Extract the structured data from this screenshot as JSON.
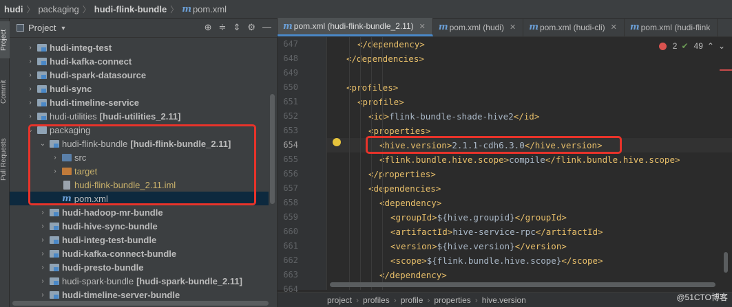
{
  "breadcrumb": {
    "items": [
      "hudi",
      "packaging",
      "hudi-flink-bundle"
    ],
    "file": "pom.xml",
    "file_icon": "m"
  },
  "toolstrip": {
    "tabs": [
      "Project",
      "Commit",
      "Pull Requests"
    ]
  },
  "project_panel": {
    "title": "Project",
    "icons": [
      "locate-icon",
      "expand-icon",
      "collapse-icon",
      "gear-icon",
      "minimize-icon"
    ],
    "rows": [
      {
        "indent": 1,
        "arrow": "›",
        "icon": "mod",
        "name": "hudi-integ-test",
        "suffix": "",
        "bold": true,
        "color": "default"
      },
      {
        "indent": 1,
        "arrow": "›",
        "icon": "mod",
        "name": "hudi-kafka-connect",
        "suffix": "",
        "bold": true,
        "color": "default"
      },
      {
        "indent": 1,
        "arrow": "›",
        "icon": "mod",
        "name": "hudi-spark-datasource",
        "suffix": "",
        "bold": true,
        "color": "default"
      },
      {
        "indent": 1,
        "arrow": "›",
        "icon": "mod",
        "name": "hudi-sync",
        "suffix": "",
        "bold": true,
        "color": "default"
      },
      {
        "indent": 1,
        "arrow": "›",
        "icon": "mod",
        "name": "hudi-timeline-service",
        "suffix": "",
        "bold": true,
        "color": "default"
      },
      {
        "indent": 1,
        "arrow": "›",
        "icon": "mod",
        "name": "hudi-utilities",
        "suffix": "[hudi-utilities_2.11]",
        "bold": false,
        "color": "default"
      },
      {
        "indent": 1,
        "arrow": "⌄",
        "icon": "plain",
        "name": "packaging",
        "suffix": "",
        "bold": false,
        "color": "default"
      },
      {
        "indent": 2,
        "arrow": "⌄",
        "icon": "mod",
        "name": "hudi-flink-bundle",
        "suffix": "[hudi-flink-bundle_2.11]",
        "bold": false,
        "color": "default"
      },
      {
        "indent": 3,
        "arrow": "›",
        "icon": "src",
        "name": "src",
        "suffix": "",
        "bold": false,
        "color": "default"
      },
      {
        "indent": 3,
        "arrow": "›",
        "icon": "target",
        "name": "target",
        "suffix": "",
        "bold": false,
        "color": "yellow"
      },
      {
        "indent": 3,
        "arrow": "",
        "icon": "iml",
        "name": "hudi-flink-bundle_2.11.iml",
        "suffix": "",
        "bold": false,
        "color": "yellow"
      },
      {
        "indent": 3,
        "arrow": "",
        "icon": "m",
        "name": "pom.xml",
        "suffix": "",
        "bold": false,
        "color": "default",
        "selected": true
      },
      {
        "indent": 2,
        "arrow": "›",
        "icon": "mod",
        "name": "hudi-hadoop-mr-bundle",
        "suffix": "",
        "bold": true,
        "color": "default"
      },
      {
        "indent": 2,
        "arrow": "›",
        "icon": "mod",
        "name": "hudi-hive-sync-bundle",
        "suffix": "",
        "bold": true,
        "color": "default"
      },
      {
        "indent": 2,
        "arrow": "›",
        "icon": "mod",
        "name": "hudi-integ-test-bundle",
        "suffix": "",
        "bold": true,
        "color": "default"
      },
      {
        "indent": 2,
        "arrow": "›",
        "icon": "mod",
        "name": "hudi-kafka-connect-bundle",
        "suffix": "",
        "bold": true,
        "color": "default"
      },
      {
        "indent": 2,
        "arrow": "›",
        "icon": "mod",
        "name": "hudi-presto-bundle",
        "suffix": "",
        "bold": true,
        "color": "default"
      },
      {
        "indent": 2,
        "arrow": "›",
        "icon": "mod",
        "name": "hudi-spark-bundle",
        "suffix": "[hudi-spark-bundle_2.11]",
        "bold": false,
        "color": "default"
      },
      {
        "indent": 2,
        "arrow": "›",
        "icon": "mod",
        "name": "hudi-timeline-server-bundle",
        "suffix": "",
        "bold": true,
        "color": "default"
      }
    ]
  },
  "editor": {
    "tabs": [
      {
        "label": "pom.xml (hudi-flink-bundle_2.11)",
        "active": true
      },
      {
        "label": "pom.xml (hudi)",
        "active": false
      },
      {
        "label": "pom.xml (hudi-cli)",
        "active": false
      },
      {
        "label": "pom.xml (hudi-flink",
        "active": false
      }
    ],
    "inspections": {
      "errors": "2",
      "warnings": "49"
    },
    "lines": [
      {
        "no": "647",
        "indent": 2,
        "tokens": [
          [
            "tag",
            "</dependency>"
          ]
        ]
      },
      {
        "no": "648",
        "indent": 1,
        "tokens": [
          [
            "tag",
            "</dependencies>"
          ]
        ]
      },
      {
        "no": "649",
        "indent": 0,
        "tokens": []
      },
      {
        "no": "650",
        "indent": 1,
        "tokens": [
          [
            "tag",
            "<profiles>"
          ]
        ]
      },
      {
        "no": "651",
        "indent": 2,
        "tokens": [
          [
            "tag",
            "<profile>"
          ]
        ]
      },
      {
        "no": "652",
        "indent": 3,
        "tokens": [
          [
            "tag",
            "<id>"
          ],
          [
            "txt",
            "flink-bundle-shade-hive2"
          ],
          [
            "tag",
            "</id>"
          ]
        ]
      },
      {
        "no": "653",
        "indent": 3,
        "tokens": [
          [
            "tag",
            "<properties>"
          ]
        ]
      },
      {
        "no": "654",
        "indent": 4,
        "tokens": [
          [
            "tag",
            "<hive.version>"
          ],
          [
            "txt",
            "2.1.1-cdh6.3.0"
          ],
          [
            "tag",
            "</hive.version>"
          ]
        ],
        "current": true
      },
      {
        "no": "655",
        "indent": 4,
        "tokens": [
          [
            "tag",
            "<flink.bundle.hive.scope>"
          ],
          [
            "txt",
            "compile"
          ],
          [
            "tag",
            "</flink.bundle.hive.scope>"
          ]
        ]
      },
      {
        "no": "656",
        "indent": 3,
        "tokens": [
          [
            "tag",
            "</properties>"
          ]
        ]
      },
      {
        "no": "657",
        "indent": 3,
        "tokens": [
          [
            "tag",
            "<dependencies>"
          ]
        ]
      },
      {
        "no": "658",
        "indent": 4,
        "tokens": [
          [
            "tag",
            "<dependency>"
          ]
        ]
      },
      {
        "no": "659",
        "indent": 5,
        "tokens": [
          [
            "tag",
            "<groupId>"
          ],
          [
            "txt",
            "${hive.groupid}"
          ],
          [
            "tag",
            "</groupId>"
          ]
        ]
      },
      {
        "no": "660",
        "indent": 5,
        "tokens": [
          [
            "tag",
            "<artifactId>"
          ],
          [
            "txt",
            "hive-service-rpc"
          ],
          [
            "tag",
            "</artifactId>"
          ]
        ]
      },
      {
        "no": "661",
        "indent": 5,
        "tokens": [
          [
            "tag",
            "<version>"
          ],
          [
            "txt",
            "${hive.version}"
          ],
          [
            "tag",
            "</version>"
          ]
        ]
      },
      {
        "no": "662",
        "indent": 5,
        "tokens": [
          [
            "tag",
            "<scope>"
          ],
          [
            "txt",
            "${flink.bundle.hive.scope}"
          ],
          [
            "tag",
            "</scope>"
          ]
        ]
      },
      {
        "no": "663",
        "indent": 4,
        "tokens": [
          [
            "tag",
            "</dependency>"
          ]
        ]
      },
      {
        "no": "664",
        "indent": 0,
        "tokens": []
      }
    ],
    "breadcrumbs": [
      "project",
      "profiles",
      "profile",
      "properties",
      "hive.version"
    ]
  },
  "watermark": "@51CTO博客",
  "colors": {
    "tag": "#e8bf6a",
    "text": "#a9b7c6",
    "highlight": "#e8332a",
    "selection": "#0d293e"
  }
}
